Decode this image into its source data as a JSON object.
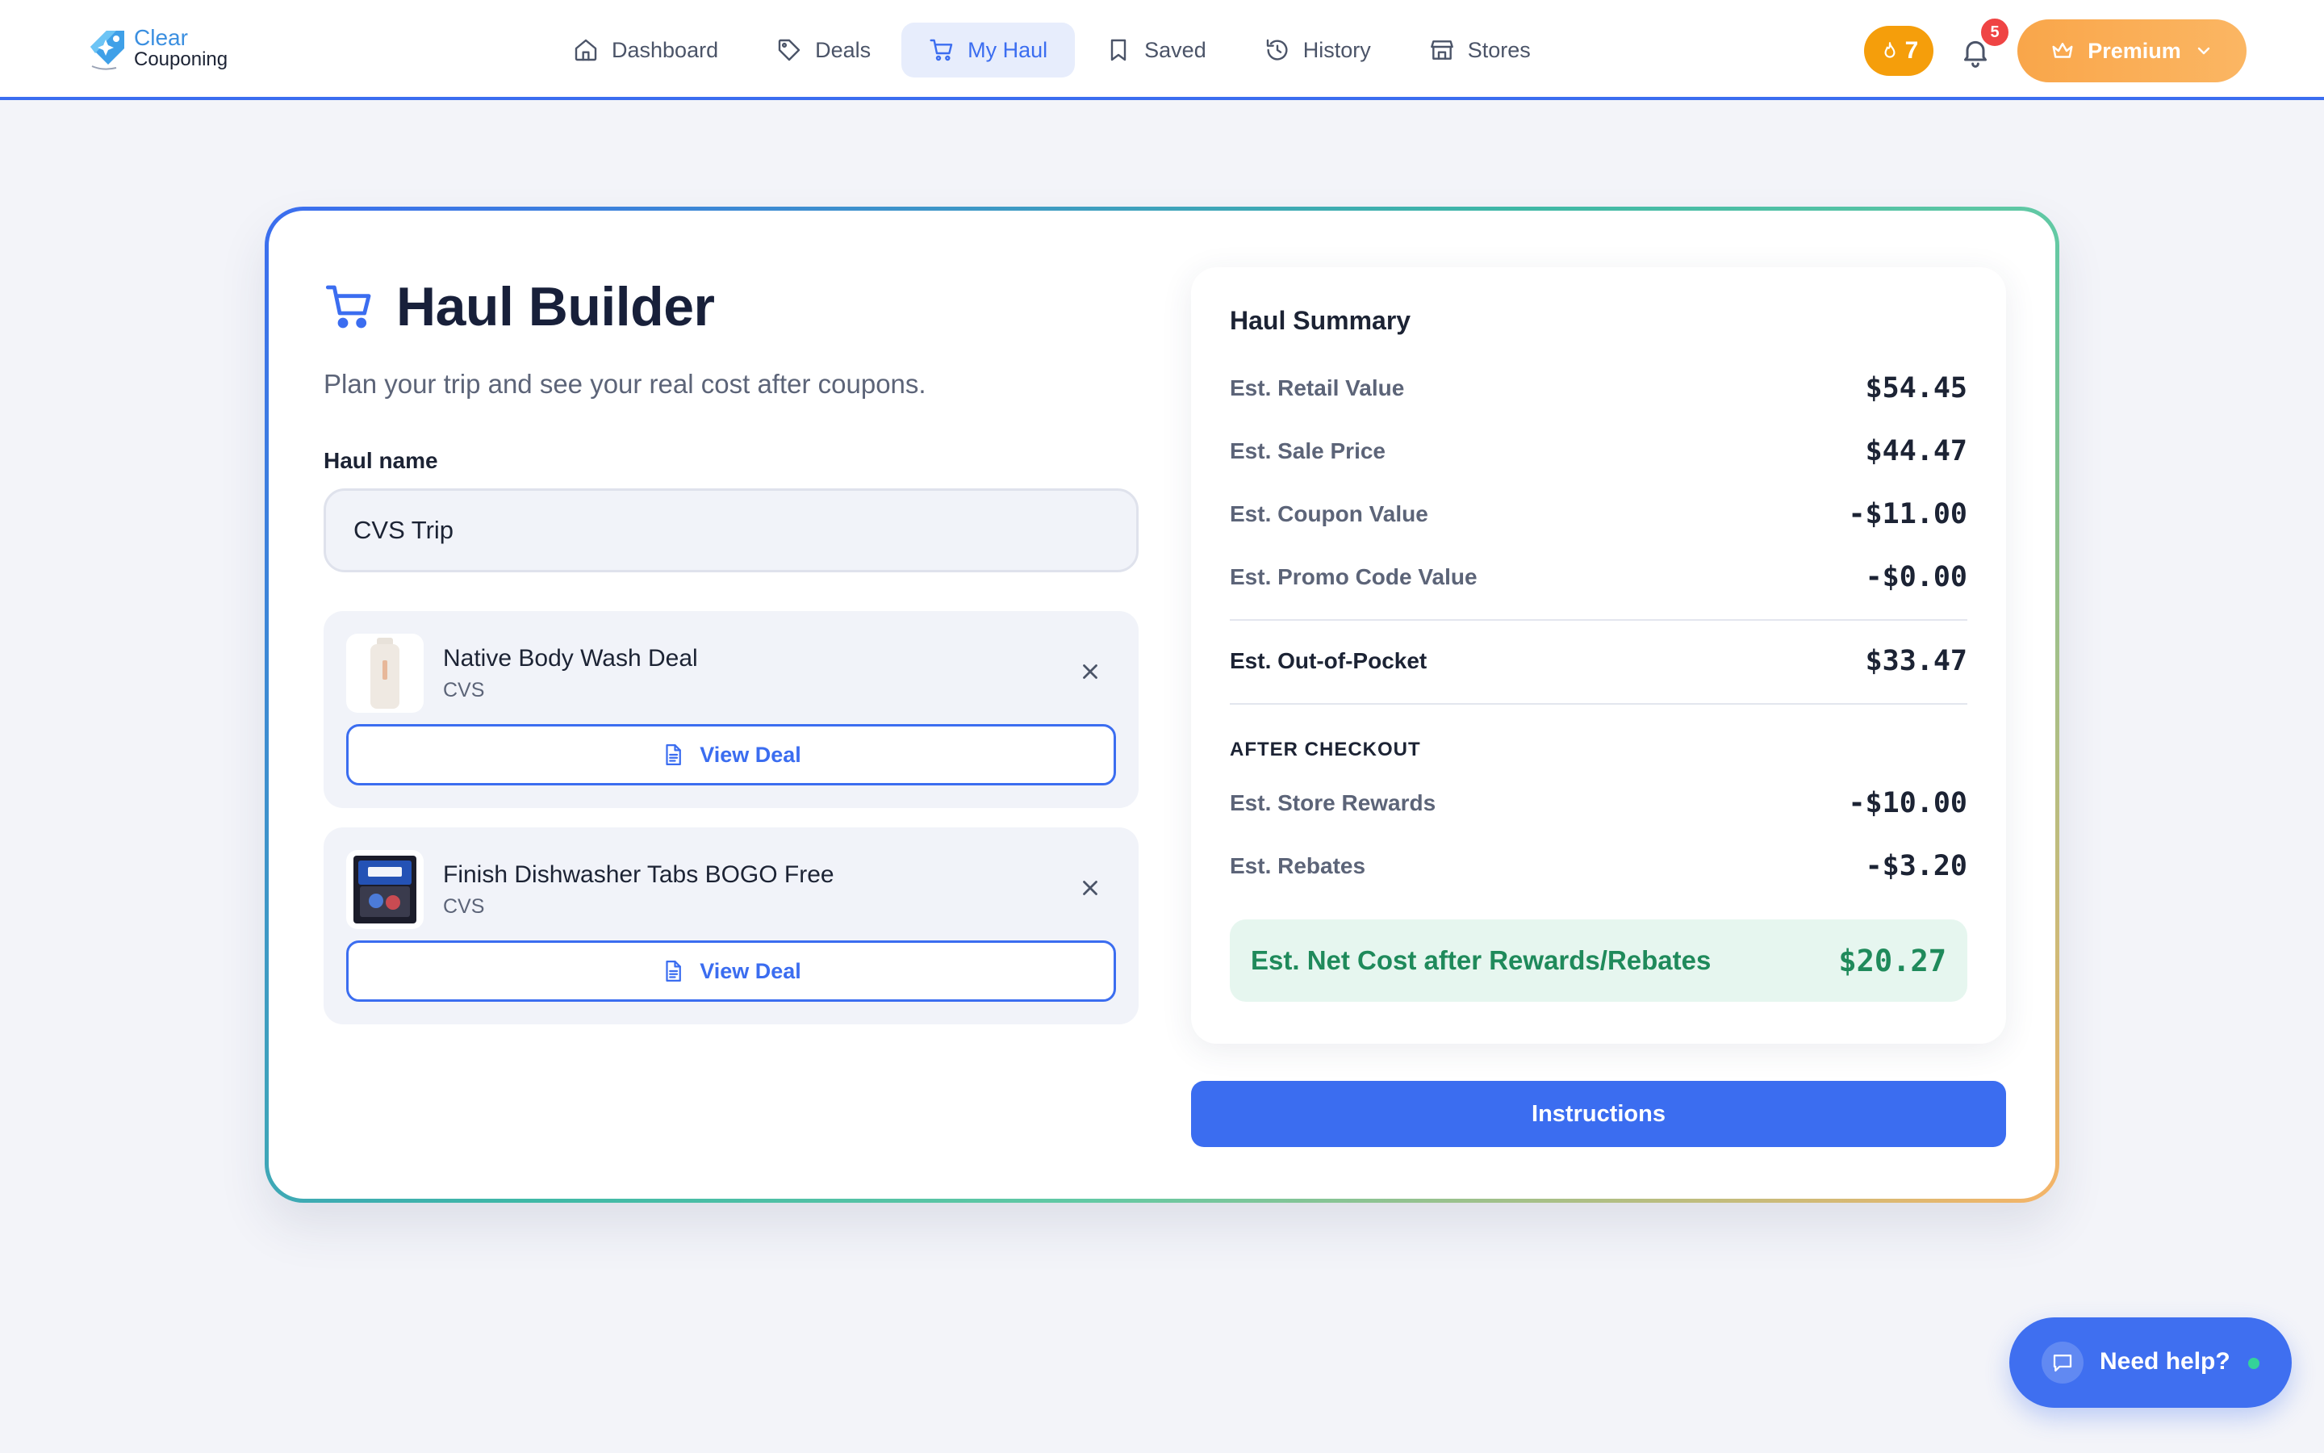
{
  "brand": {
    "line1": "Clear",
    "line2": "Couponing"
  },
  "nav": [
    {
      "label": "Dashboard",
      "icon": "home-icon"
    },
    {
      "label": "Deals",
      "icon": "tag-icon"
    },
    {
      "label": "My Haul",
      "icon": "cart-icon",
      "active": true
    },
    {
      "label": "Saved",
      "icon": "bookmark-icon"
    },
    {
      "label": "History",
      "icon": "history-icon"
    },
    {
      "label": "Stores",
      "icon": "store-icon"
    }
  ],
  "header": {
    "streak": "7",
    "notifications": "5",
    "premium_label": "Premium"
  },
  "page": {
    "title": "Haul Builder",
    "subtitle": "Plan your trip and see your real cost after coupons.",
    "haul_name_label": "Haul name",
    "haul_name_value": "CVS Trip"
  },
  "deals": [
    {
      "name": "Native Body Wash Deal",
      "store": "CVS",
      "button": "View Deal"
    },
    {
      "name": "Finish Dishwasher Tabs BOGO Free",
      "store": "CVS",
      "button": "View Deal"
    }
  ],
  "summary": {
    "title": "Haul Summary",
    "rows": [
      {
        "label": "Est. Retail Value",
        "value": "$54.45"
      },
      {
        "label": "Est. Sale Price",
        "value": "$44.47"
      },
      {
        "label": "Est. Coupon Value",
        "value": "-$11.00"
      },
      {
        "label": "Est. Promo Code Value",
        "value": "-$0.00"
      }
    ],
    "out_of_pocket": {
      "label": "Est. Out-of-Pocket",
      "value": "$33.47"
    },
    "after_checkout_label": "AFTER CHECKOUT",
    "after_rows": [
      {
        "label": "Est. Store Rewards",
        "value": "-$10.00"
      },
      {
        "label": "Est. Rebates",
        "value": "-$3.20"
      }
    ],
    "net": {
      "label": "Est. Net Cost after Rewards/Rebates",
      "value": "$20.27"
    }
  },
  "instructions_label": "Instructions",
  "help": {
    "label": "Need help?"
  },
  "colors": {
    "primary": "#3b6df0",
    "accent_orange": "#f59e0b",
    "success": "#1f8a5b"
  }
}
